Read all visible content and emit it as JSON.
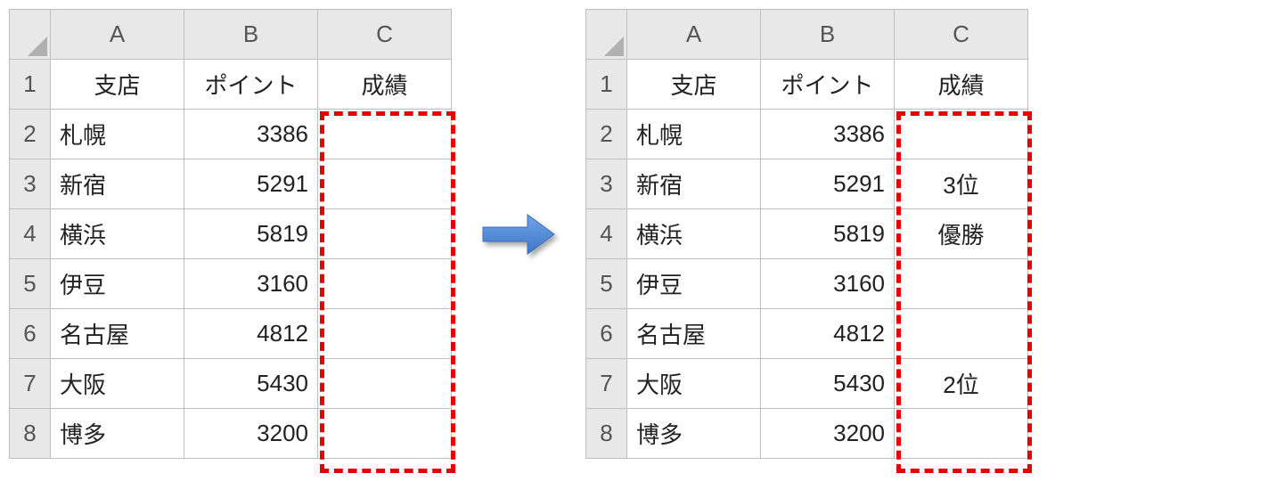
{
  "columns": {
    "A": "A",
    "B": "B",
    "C": "C"
  },
  "rownums": [
    "1",
    "2",
    "3",
    "4",
    "5",
    "6",
    "7",
    "8"
  ],
  "headers": {
    "branch": "支店",
    "points": "ポイント",
    "rank": "成績"
  },
  "rows": [
    {
      "branch": "札幌",
      "points": "3386"
    },
    {
      "branch": "新宿",
      "points": "5291"
    },
    {
      "branch": "横浜",
      "points": "5819"
    },
    {
      "branch": "伊豆",
      "points": "3160"
    },
    {
      "branch": "名古屋",
      "points": "4812"
    },
    {
      "branch": "大阪",
      "points": "5430"
    },
    {
      "branch": "博多",
      "points": "3200"
    }
  ],
  "results_left": [
    "",
    "",
    "",
    "",
    "",
    "",
    ""
  ],
  "results_right": [
    "",
    "3位",
    "優勝",
    "",
    "",
    "2位",
    ""
  ]
}
